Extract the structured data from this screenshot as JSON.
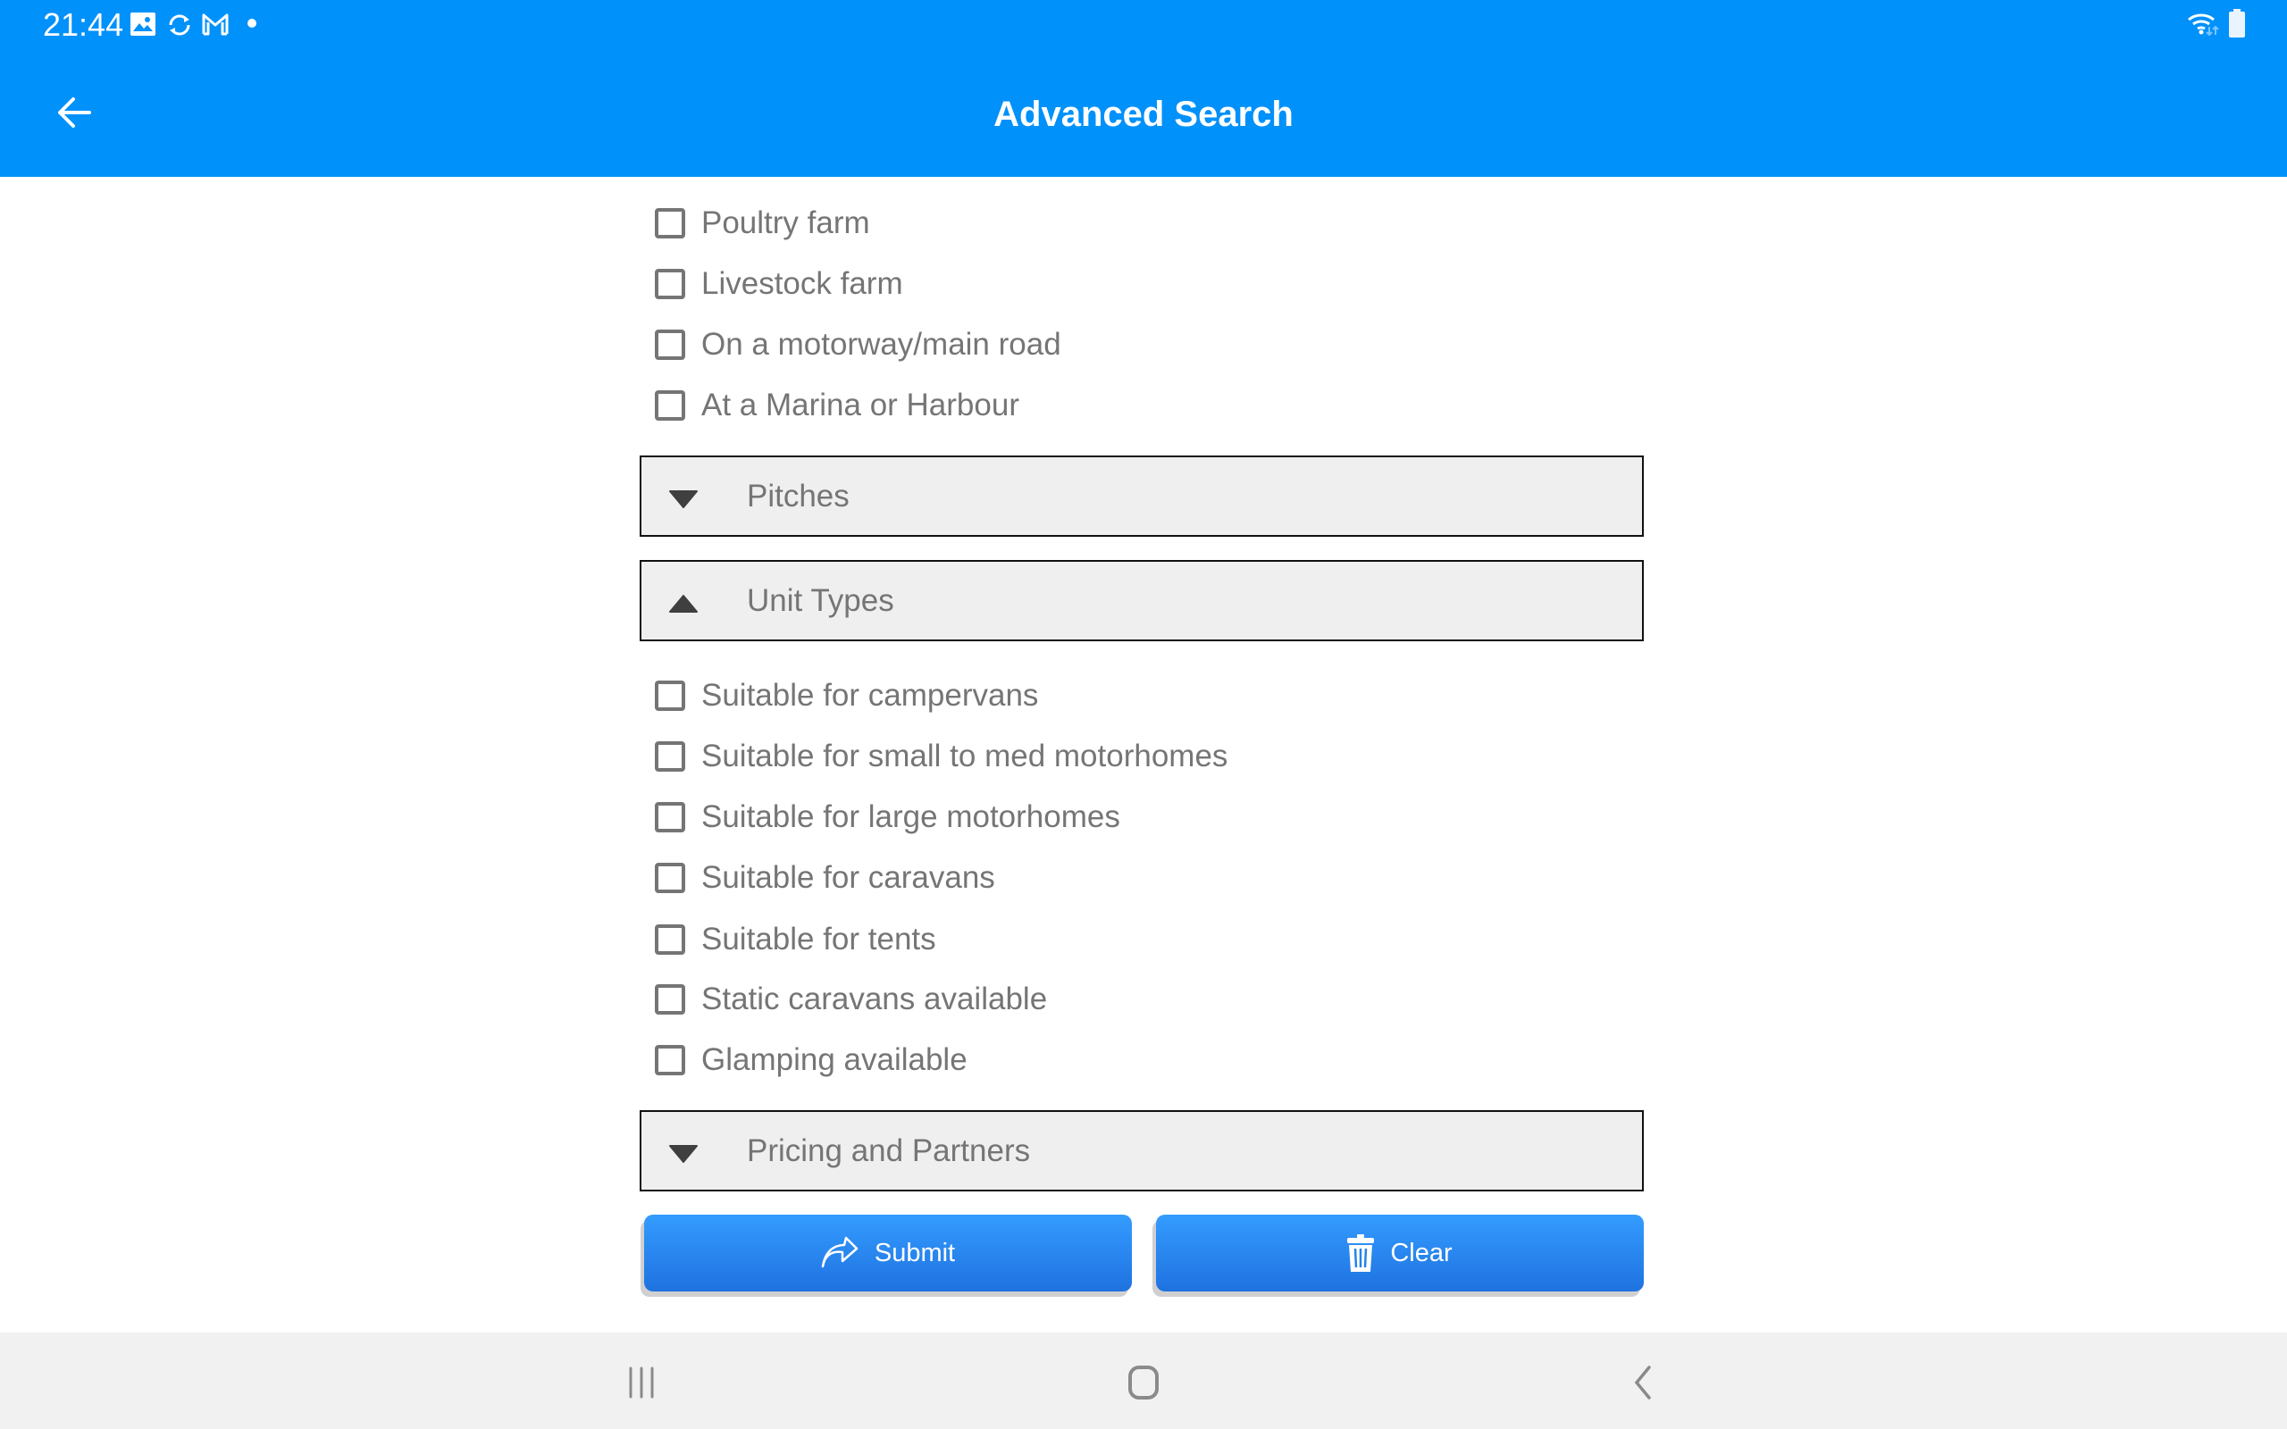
{
  "status_bar": {
    "time": "21:44",
    "left_icons": [
      "gallery-icon",
      "sync-icon",
      "gmail-icon",
      "notification-dot-icon"
    ],
    "right_icons": [
      "wifi-icon",
      "battery-icon"
    ]
  },
  "header": {
    "title": "Advanced Search",
    "back_icon": "arrow-left-icon"
  },
  "colors": {
    "header": "#0091FA",
    "button_top": "#349CFF",
    "button_bottom": "#1F72E0",
    "section_bg": "#EFEFEF",
    "text_gray": "#757575"
  },
  "location_options": [
    {
      "label": "Poultry farm",
      "checked": false
    },
    {
      "label": "Livestock farm",
      "checked": false
    },
    {
      "label": "On a motorway/main road",
      "checked": false
    },
    {
      "label": "At a Marina or Harbour",
      "checked": false
    }
  ],
  "sections": {
    "pitches": {
      "label": "Pitches",
      "expanded": false
    },
    "unit_types": {
      "label": "Unit Types",
      "expanded": true
    },
    "pricing": {
      "label": "Pricing and Partners",
      "expanded": false
    }
  },
  "unit_type_options": [
    {
      "label": "Suitable for campervans",
      "checked": false
    },
    {
      "label": "Suitable for small to med motorhomes",
      "checked": false
    },
    {
      "label": "Suitable for large motorhomes",
      "checked": false
    },
    {
      "label": "Suitable for caravans",
      "checked": false
    },
    {
      "label": "Suitable for tents",
      "checked": false
    },
    {
      "label": "Static caravans available",
      "checked": false
    },
    {
      "label": "Glamping available",
      "checked": false
    }
  ],
  "buttons": {
    "submit": "Submit",
    "clear": "Clear"
  },
  "navbar": {
    "recents_icon": "recents-icon",
    "home_icon": "home-icon",
    "back_icon": "back-chevron-icon"
  }
}
